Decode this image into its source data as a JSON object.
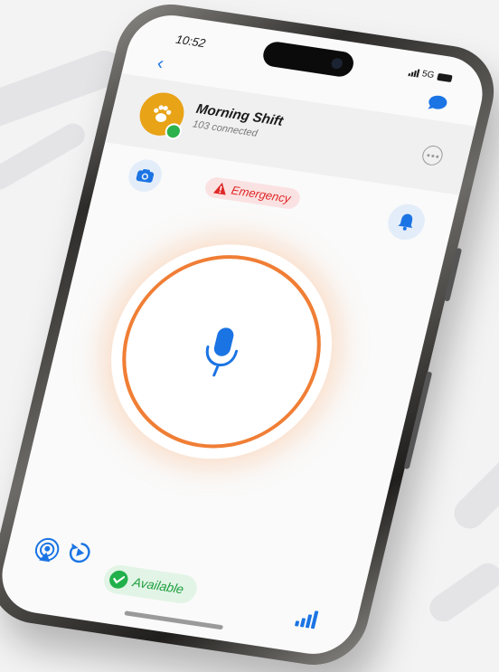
{
  "status": {
    "time": "10:52",
    "network": "5G"
  },
  "channel": {
    "name": "Morning Shift",
    "connected": "103 connected"
  },
  "emergency_label": "Emergency",
  "availability_label": "Available",
  "icons": {
    "back": "chevron-left-icon",
    "chat": "chat-bubble-icon",
    "more": "more-dots-icon",
    "camera": "camera-icon",
    "bell": "bell-icon",
    "warning": "warning-icon",
    "mic": "microphone-icon",
    "broadcast": "broadcast-icon",
    "replay": "replay-icon",
    "signal": "signal-icon"
  },
  "colors": {
    "accent": "#1b74e4",
    "ring": "#f07e35",
    "emergency": "#e02828",
    "available": "#22b04b",
    "avatar": "#e8a316"
  }
}
